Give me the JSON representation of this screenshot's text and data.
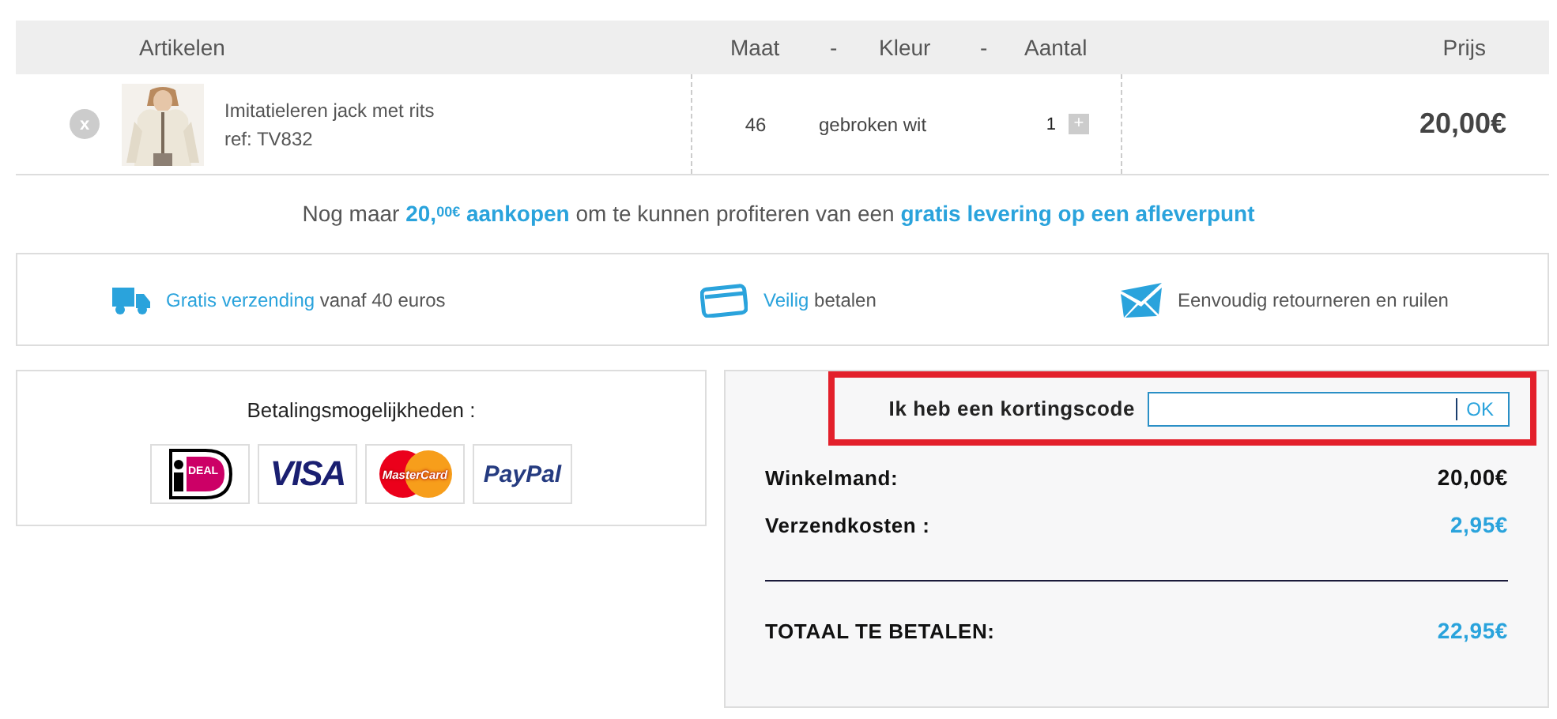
{
  "cart": {
    "columns": {
      "article": "Artikelen",
      "size": "Maat",
      "sep_1": "-",
      "shade": "Kleur",
      "sep_2": "-",
      "quantity": "Aantal",
      "price": "Prijs"
    },
    "items": [
      {
        "remove": "x",
        "name": "Imitatieleren jack met rits",
        "ref": "ref: TV832",
        "size": "46",
        "shade": "gebroken wit",
        "quantity": "1",
        "increase": "+",
        "price": "20,00€"
      }
    ]
  },
  "notice": "Nog maar **20,$^{00€}$ aankopen** om te kunnen profiteren van een **gratis levering op een afleverpunt**",
  "features": [
    {
      "kind": "truck",
      "highlight": "Gratis verzending",
      "text": " vanaf 40 euros"
    },
    {
      "kind": "card",
      "highlight": "Veilig",
      "text": " betalen"
    },
    {
      "kind": "mail",
      "text": "Eenvoudig retourneren en ruilen"
    }
  ],
  "payment": {
    "title": "Betalingsmogelijkheden :",
    "methods": [
      {
        "kind": "ideal",
        "label": "DEAL"
      },
      {
        "kind": "visa",
        "label": "VISA"
      },
      {
        "kind": "mastercard",
        "label": "MasterCard"
      },
      {
        "kind": "paypal",
        "label": "PayPal"
      }
    ]
  },
  "summary": {
    "coupon": {
      "label": "Ik heb een kortingscode",
      "button": "OK"
    },
    "lines": [
      {
        "label": "Winkelmand:",
        "value": "20,00€",
        "kind": "subtotal"
      },
      {
        "label": "Verzendkosten :",
        "value": "2,95€",
        "kind": "shipping"
      }
    ],
    "total": {
      "label": "TOTAAL TE BETALEN:",
      "value": "22,95€"
    }
  }
}
